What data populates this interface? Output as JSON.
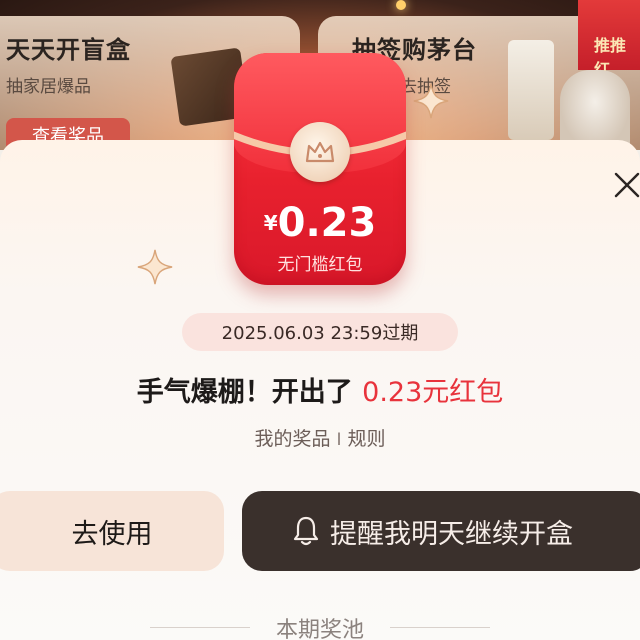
{
  "background": {
    "left_card": {
      "title": "天天开盲盒",
      "subtitle": "抽家居爆品",
      "button_label": "查看奖品"
    },
    "right_card": {
      "title": "抽签购茅台",
      "subtitle": "去抽签",
      "banner_text": "推推红"
    }
  },
  "envelope": {
    "currency": "¥",
    "amount": "0.23",
    "label": "无门槛红包",
    "medal_icon": "crown-icon",
    "color": "#e8212e"
  },
  "expiry": {
    "text": "2025.06.03 23:59过期"
  },
  "result": {
    "prefix": "手气爆棚！开出了 ",
    "amount_text": "0.23元红包",
    "amount_color": "#e8333c"
  },
  "links": {
    "my_prizes": "我的奖品",
    "separator": "I",
    "rules": "规则"
  },
  "buttons": {
    "use_label": "去使用",
    "remind_label": "提醒我明天继续开盒",
    "remind_icon": "bell-icon"
  },
  "prize_pool": {
    "title": "本期奖池"
  },
  "close_icon": "close-icon"
}
